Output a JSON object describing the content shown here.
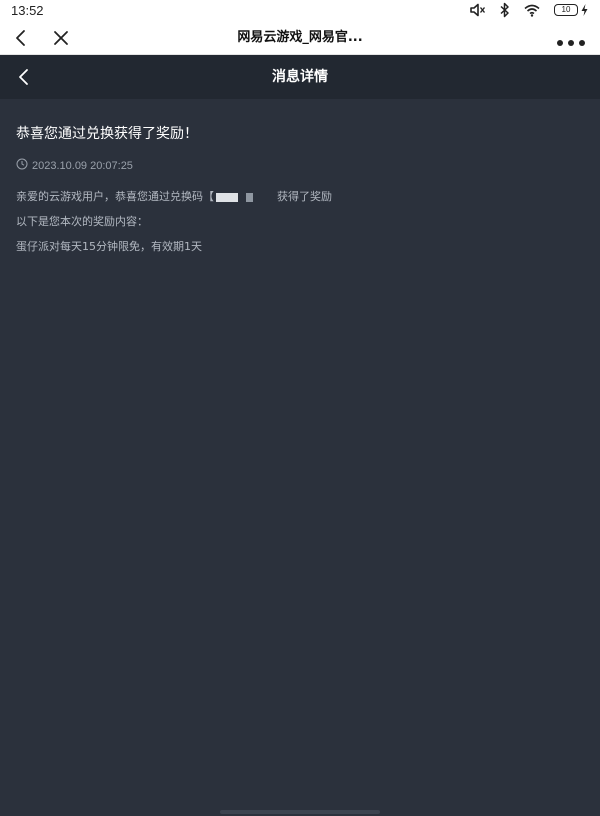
{
  "status_bar": {
    "time": "13:52",
    "battery_level": "10",
    "icons": [
      "mute-icon",
      "bluetooth-icon",
      "wifi-icon",
      "battery-icon",
      "charging-icon"
    ]
  },
  "browser": {
    "title": "网易云游戏_网易官..."
  },
  "app_header": {
    "title": "消息详情"
  },
  "message": {
    "title": "恭喜您通过兑换获得了奖励！",
    "timestamp": "2023.10.09 20:07:25",
    "line1_prefix": "亲爱的云游戏用户，恭喜您通过兑换码【",
    "line1_suffix": "获得了奖励",
    "line2": "以下是您本次的奖励内容：",
    "line3": "蛋仔派对每天15分钟限免，有效期1天"
  },
  "colors": {
    "background": "#2b313c",
    "header": "#222831",
    "text_primary": "#ffffff",
    "text_secondary": "#b2b8c1"
  }
}
